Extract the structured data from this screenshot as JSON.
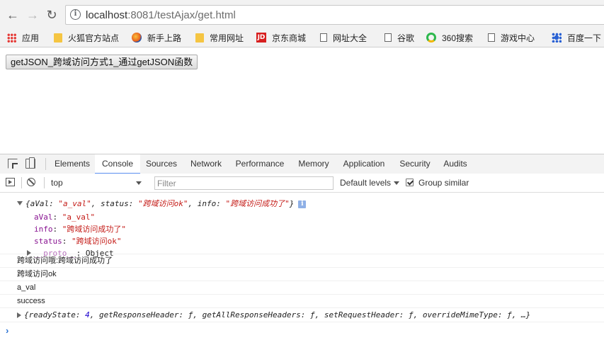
{
  "browser": {
    "url_host": "localhost",
    "url_rest": ":8081/testAjax/get.html",
    "bookmarks": [
      "应用",
      "火狐官方站点",
      "新手上路",
      "常用网址",
      "京东商城",
      "网址大全",
      "谷歌",
      "360搜索",
      "游戏中心",
      "百度一下"
    ]
  },
  "page": {
    "button_label": "getJSON_跨域访问方式1_通过getJSON函数"
  },
  "devtools": {
    "tabs": [
      "Elements",
      "Console",
      "Sources",
      "Network",
      "Performance",
      "Memory",
      "Application",
      "Security",
      "Audits"
    ],
    "active_tab": "Console",
    "context": "top",
    "filter_placeholder": "Filter",
    "levels_label": "Default levels",
    "group_similar_label": "Group similar",
    "group_similar_checked": true
  },
  "console": {
    "object_preview": {
      "open": "{",
      "k1": "aVal: ",
      "v1": "\"a_val\"",
      "k2": ", status: ",
      "v2": "\"跨域访问ok\"",
      "k3": ", info: ",
      "v3": "\"跨域访问成功了\"",
      "close": "}"
    },
    "props": [
      {
        "key": "aVal",
        "value": "\"a_val\""
      },
      {
        "key": "info",
        "value": "\"跨域访问成功了\""
      },
      {
        "key": "status",
        "value": "\"跨域访问ok\""
      }
    ],
    "proto": {
      "key": "__proto__",
      "value": "Object"
    },
    "lines": [
      "跨域访问哦:跨域访问成功了",
      "跨域访问ok",
      "a_val",
      "success"
    ],
    "xhr_preview": {
      "open": "{readyState: ",
      "ready_state": "4",
      "rest": ", getResponseHeader: ƒ, getAllResponseHeaders: ƒ, setRequestHeader: ƒ, overrideMimeType: ƒ, …}"
    },
    "prompt": "›"
  }
}
